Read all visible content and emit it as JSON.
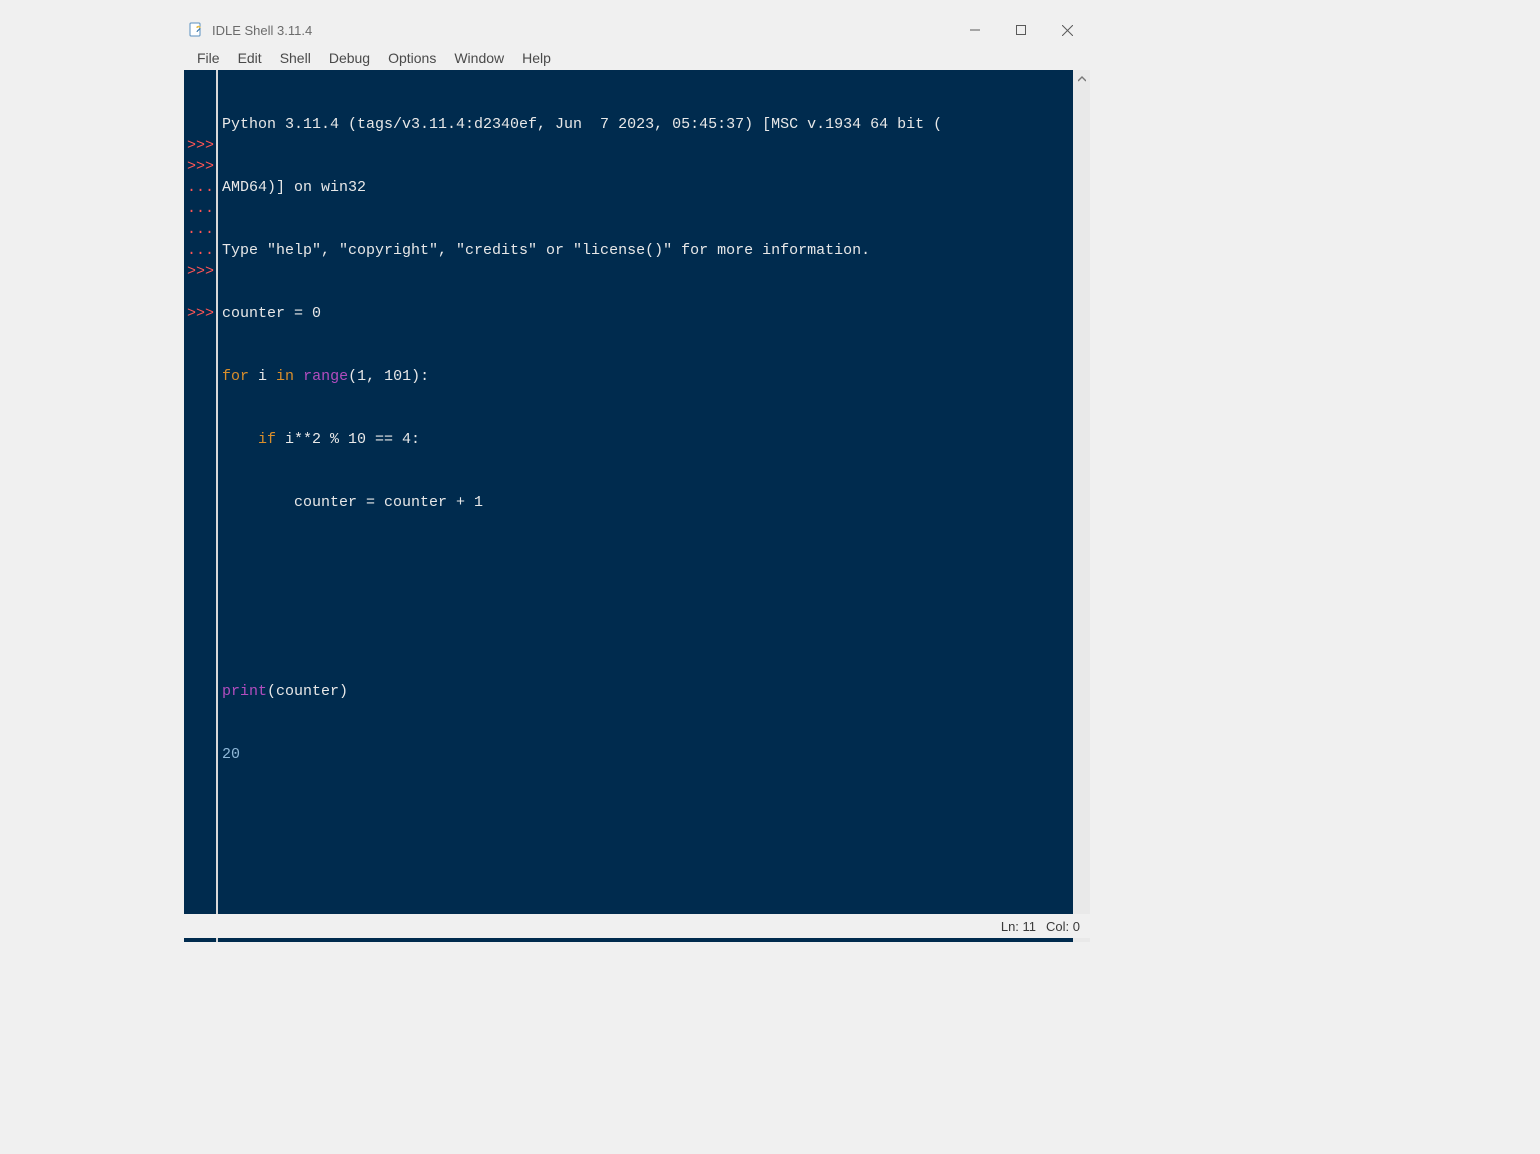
{
  "window": {
    "title": "IDLE Shell 3.11.4"
  },
  "menu": {
    "items": [
      "File",
      "Edit",
      "Shell",
      "Debug",
      "Options",
      "Window",
      "Help"
    ]
  },
  "gutter": [
    "",
    "",
    "",
    ">>>",
    ">>>",
    "...",
    "...",
    "...",
    "...",
    ">>>",
    "",
    ">>>"
  ],
  "code": {
    "banner1": "Python 3.11.4 (tags/v3.11.4:d2340ef, Jun  7 2023, 05:45:37) [MSC v.1934 64 bit (",
    "banner2": "AMD64)] on win32",
    "banner3": "Type \"help\", \"copyright\", \"credits\" or \"license()\" for more information.",
    "l1": "counter = 0",
    "l2a": "for",
    "l2b": " i ",
    "l2c": "in",
    "l2d": " ",
    "l2e": "range",
    "l2f": "(1, 101):",
    "l3a": "    ",
    "l3b": "if",
    "l3c": " i**2 % 10 == 4:",
    "l4": "        counter = counter + 1",
    "l5": "",
    "l6": "",
    "l7a": "print",
    "l7b": "(counter)",
    "out": "20"
  },
  "status": {
    "ln": "Ln: 11",
    "col": "Col: 0"
  }
}
